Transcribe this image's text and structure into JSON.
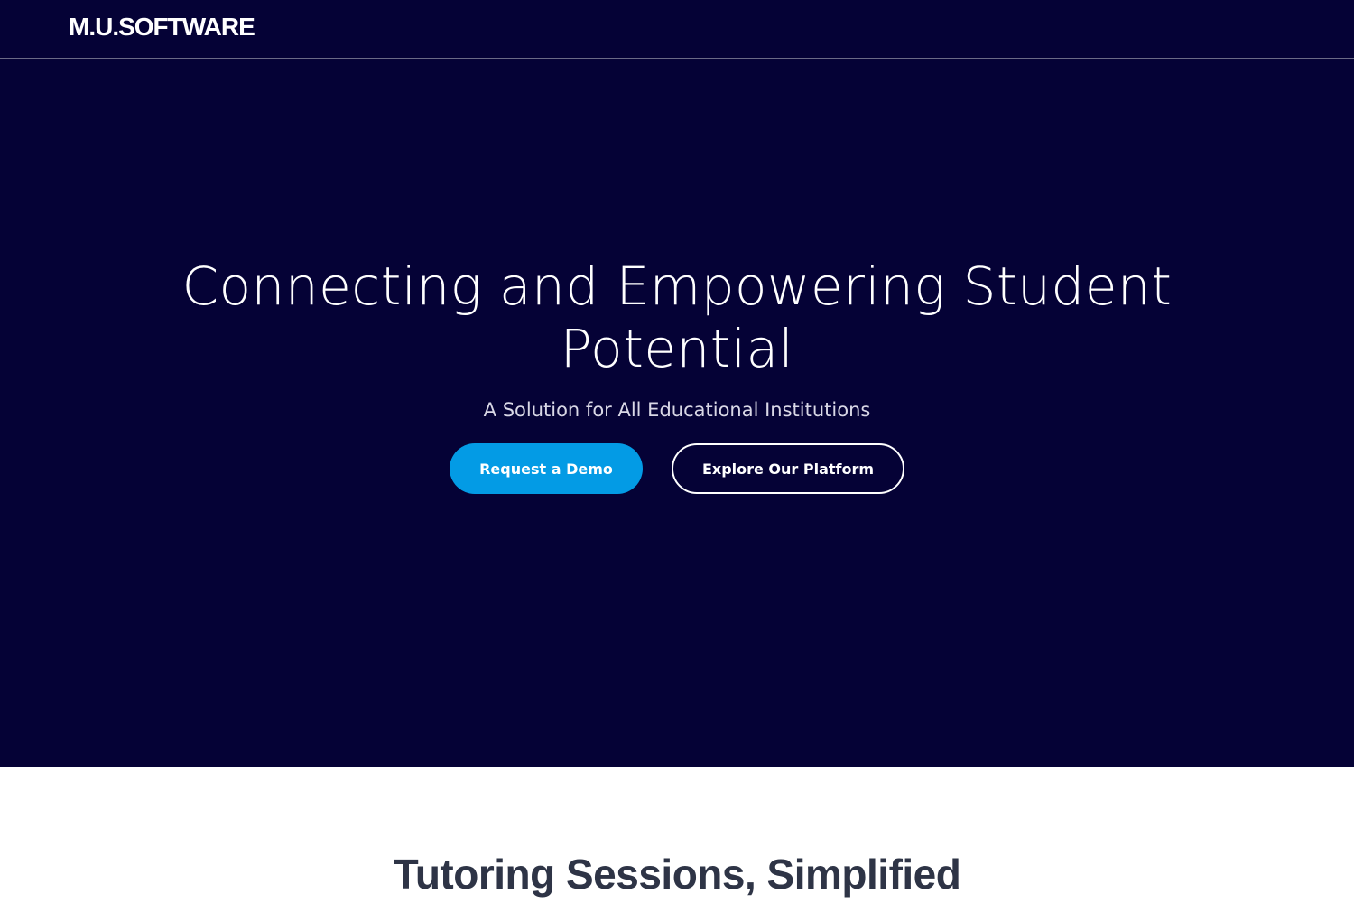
{
  "header": {
    "logo_text": "M.U.SOFTWARE"
  },
  "hero": {
    "title": "Connecting and Empowering Student Potential",
    "subtitle": "A Solution for All Educational Institutions",
    "primary_button_label": "Request a Demo",
    "secondary_button_label": "Explore Our Platform"
  },
  "features": {
    "section_title": "Tutoring Sessions, Simplified"
  },
  "colors": {
    "background_dark": "#050236",
    "accent": "#039be5",
    "text_light": "#ffffff",
    "heading_dark": "#2e3446"
  }
}
